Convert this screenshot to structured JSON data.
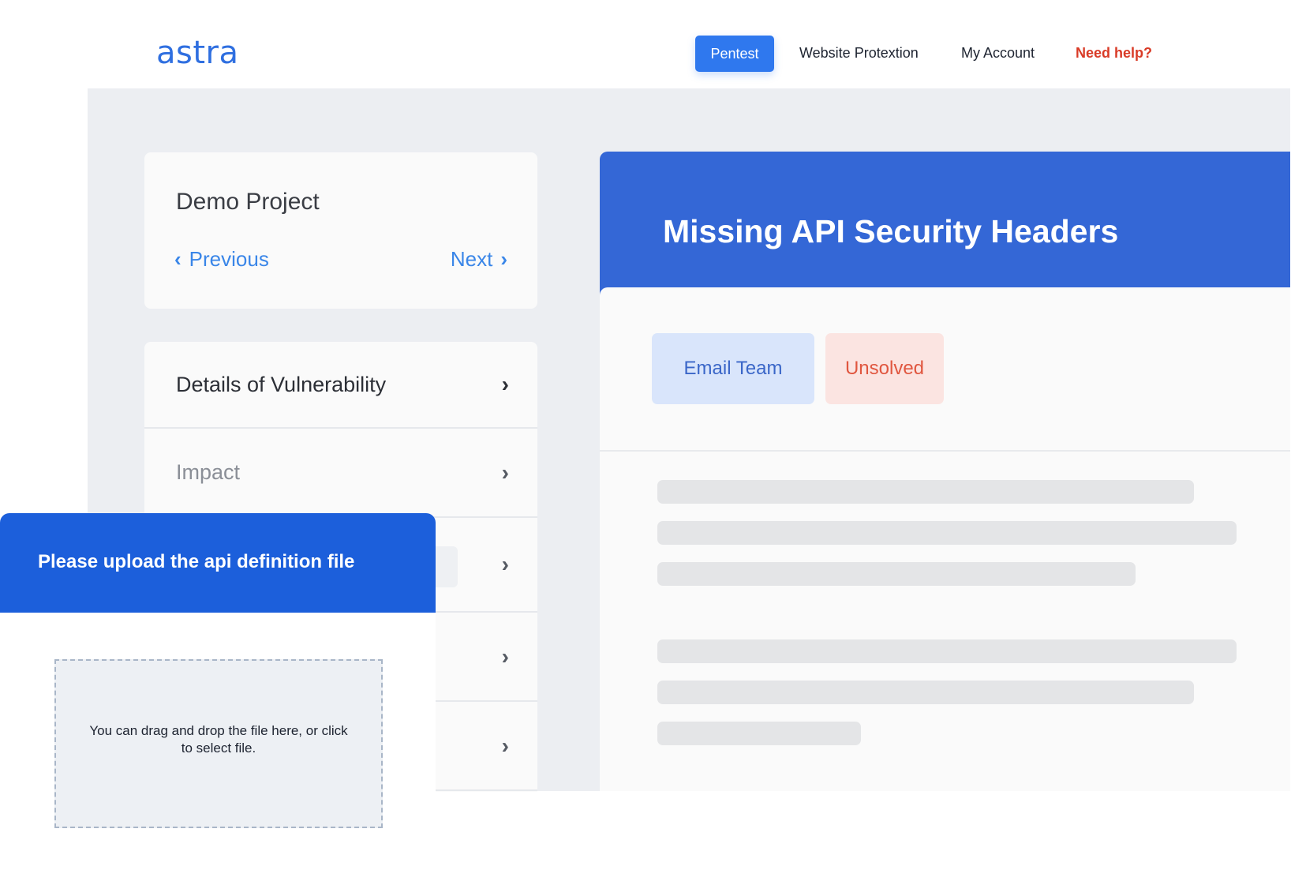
{
  "nav": {
    "logo": "astra",
    "pentest": "Pentest",
    "website_protection": "Website Protextion",
    "my_account": "My Account",
    "need_help": "Need help?"
  },
  "project": {
    "title": "Demo Project",
    "previous": "Previous",
    "next": "Next"
  },
  "details": {
    "items": [
      {
        "label": "Details of Vulnerability"
      },
      {
        "label": "Impact"
      },
      {
        "label": ""
      },
      {
        "label": ""
      },
      {
        "label": ""
      }
    ]
  },
  "vulnerability": {
    "title": "Missing API Security Headers",
    "email_team": "Email Team",
    "status": "Unsolved"
  },
  "upload": {
    "title": "Please upload the api definition file",
    "dropzone_text": "You can drag and drop the file here, or click to select file."
  },
  "colors": {
    "primary": "#2f78ee",
    "header_blue": "#3467d6",
    "upload_blue": "#1c5fdb",
    "help_red": "#d93b27",
    "status_red": "#e0563f",
    "canvas_bg": "#eceef2"
  },
  "icons": {
    "previous": "chevron-left-icon",
    "next": "chevron-right-icon",
    "row_arrow": "chevron-right-icon"
  }
}
